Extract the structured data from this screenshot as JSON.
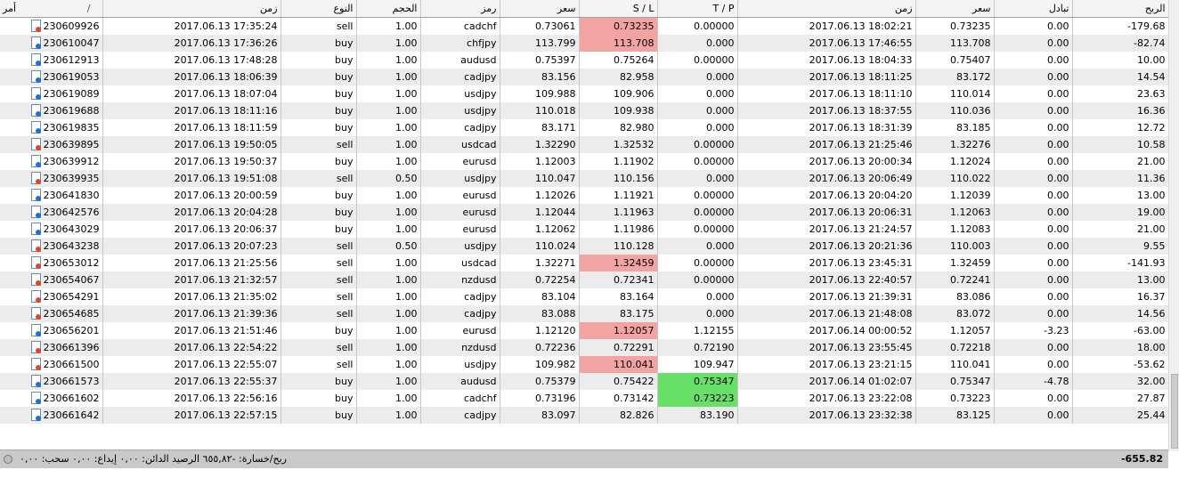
{
  "columns": {
    "order": "أمر",
    "open_time": "زمن",
    "type": "النوع",
    "volume": "الحجم",
    "symbol": "رمز",
    "open_price": "سعر",
    "sl": "S / L",
    "tp": "T / P",
    "close_time": "زمن",
    "close_price": "سعر",
    "swap": "تبادل",
    "profit": "الربح",
    "sort_indicator": "/"
  },
  "rows": [
    {
      "order": "230609926",
      "open_time": "2017.06.13 17:35:24",
      "type": "sell",
      "volume": "1.00",
      "symbol": "cadchf",
      "open_price": "0.73061",
      "sl": "0.73235",
      "tp": "0.00000",
      "close_time": "2017.06.13 18:02:21",
      "close_price": "0.73235",
      "swap": "0.00",
      "profit": "-179.68",
      "sl_hl": "red",
      "tp_hl": ""
    },
    {
      "order": "230610047",
      "open_time": "2017.06.13 17:36:26",
      "type": "buy",
      "volume": "1.00",
      "symbol": "chfjpy",
      "open_price": "113.799",
      "sl": "113.708",
      "tp": "0.000",
      "close_time": "2017.06.13 17:46:55",
      "close_price": "113.708",
      "swap": "0.00",
      "profit": "-82.74",
      "sl_hl": "red",
      "tp_hl": ""
    },
    {
      "order": "230612913",
      "open_time": "2017.06.13 17:48:28",
      "type": "buy",
      "volume": "1.00",
      "symbol": "audusd",
      "open_price": "0.75397",
      "sl": "0.75264",
      "tp": "0.00000",
      "close_time": "2017.06.13 18:04:33",
      "close_price": "0.75407",
      "swap": "0.00",
      "profit": "10.00",
      "sl_hl": "",
      "tp_hl": ""
    },
    {
      "order": "230619053",
      "open_time": "2017.06.13 18:06:39",
      "type": "buy",
      "volume": "1.00",
      "symbol": "cadjpy",
      "open_price": "83.156",
      "sl": "82.958",
      "tp": "0.000",
      "close_time": "2017.06.13 18:11:25",
      "close_price": "83.172",
      "swap": "0.00",
      "profit": "14.54",
      "sl_hl": "",
      "tp_hl": ""
    },
    {
      "order": "230619089",
      "open_time": "2017.06.13 18:07:04",
      "type": "buy",
      "volume": "1.00",
      "symbol": "usdjpy",
      "open_price": "109.988",
      "sl": "109.906",
      "tp": "0.000",
      "close_time": "2017.06.13 18:11:10",
      "close_price": "110.014",
      "swap": "0.00",
      "profit": "23.63",
      "sl_hl": "",
      "tp_hl": ""
    },
    {
      "order": "230619688",
      "open_time": "2017.06.13 18:11:16",
      "type": "buy",
      "volume": "1.00",
      "symbol": "usdjpy",
      "open_price": "110.018",
      "sl": "109.938",
      "tp": "0.000",
      "close_time": "2017.06.13 18:37:55",
      "close_price": "110.036",
      "swap": "0.00",
      "profit": "16.36",
      "sl_hl": "",
      "tp_hl": ""
    },
    {
      "order": "230619835",
      "open_time": "2017.06.13 18:11:59",
      "type": "buy",
      "volume": "1.00",
      "symbol": "cadjpy",
      "open_price": "83.171",
      "sl": "82.980",
      "tp": "0.000",
      "close_time": "2017.06.13 18:31:39",
      "close_price": "83.185",
      "swap": "0.00",
      "profit": "12.72",
      "sl_hl": "",
      "tp_hl": ""
    },
    {
      "order": "230639895",
      "open_time": "2017.06.13 19:50:05",
      "type": "sell",
      "volume": "1.00",
      "symbol": "usdcad",
      "open_price": "1.32290",
      "sl": "1.32532",
      "tp": "0.00000",
      "close_time": "2017.06.13 21:25:46",
      "close_price": "1.32276",
      "swap": "0.00",
      "profit": "10.58",
      "sl_hl": "",
      "tp_hl": ""
    },
    {
      "order": "230639912",
      "open_time": "2017.06.13 19:50:37",
      "type": "buy",
      "volume": "1.00",
      "symbol": "eurusd",
      "open_price": "1.12003",
      "sl": "1.11902",
      "tp": "0.00000",
      "close_time": "2017.06.13 20:00:34",
      "close_price": "1.12024",
      "swap": "0.00",
      "profit": "21.00",
      "sl_hl": "",
      "tp_hl": ""
    },
    {
      "order": "230639935",
      "open_time": "2017.06.13 19:51:08",
      "type": "sell",
      "volume": "0.50",
      "symbol": "usdjpy",
      "open_price": "110.047",
      "sl": "110.156",
      "tp": "0.000",
      "close_time": "2017.06.13 20:06:49",
      "close_price": "110.022",
      "swap": "0.00",
      "profit": "11.36",
      "sl_hl": "",
      "tp_hl": ""
    },
    {
      "order": "230641830",
      "open_time": "2017.06.13 20:00:59",
      "type": "buy",
      "volume": "1.00",
      "symbol": "eurusd",
      "open_price": "1.12026",
      "sl": "1.11921",
      "tp": "0.00000",
      "close_time": "2017.06.13 20:04:20",
      "close_price": "1.12039",
      "swap": "0.00",
      "profit": "13.00",
      "sl_hl": "",
      "tp_hl": ""
    },
    {
      "order": "230642576",
      "open_time": "2017.06.13 20:04:28",
      "type": "buy",
      "volume": "1.00",
      "symbol": "eurusd",
      "open_price": "1.12044",
      "sl": "1.11963",
      "tp": "0.00000",
      "close_time": "2017.06.13 20:06:31",
      "close_price": "1.12063",
      "swap": "0.00",
      "profit": "19.00",
      "sl_hl": "",
      "tp_hl": ""
    },
    {
      "order": "230643029",
      "open_time": "2017.06.13 20:06:37",
      "type": "buy",
      "volume": "1.00",
      "symbol": "eurusd",
      "open_price": "1.12062",
      "sl": "1.11986",
      "tp": "0.00000",
      "close_time": "2017.06.13 21:24:57",
      "close_price": "1.12083",
      "swap": "0.00",
      "profit": "21.00",
      "sl_hl": "",
      "tp_hl": ""
    },
    {
      "order": "230643238",
      "open_time": "2017.06.13 20:07:23",
      "type": "sell",
      "volume": "0.50",
      "symbol": "usdjpy",
      "open_price": "110.024",
      "sl": "110.128",
      "tp": "0.000",
      "close_time": "2017.06.13 20:21:36",
      "close_price": "110.003",
      "swap": "0.00",
      "profit": "9.55",
      "sl_hl": "",
      "tp_hl": ""
    },
    {
      "order": "230653012",
      "open_time": "2017.06.13 21:25:56",
      "type": "sell",
      "volume": "1.00",
      "symbol": "usdcad",
      "open_price": "1.32271",
      "sl": "1.32459",
      "tp": "0.00000",
      "close_time": "2017.06.13 23:45:31",
      "close_price": "1.32459",
      "swap": "0.00",
      "profit": "-141.93",
      "sl_hl": "red",
      "tp_hl": ""
    },
    {
      "order": "230654067",
      "open_time": "2017.06.13 21:32:57",
      "type": "sell",
      "volume": "1.00",
      "symbol": "nzdusd",
      "open_price": "0.72254",
      "sl": "0.72341",
      "tp": "0.00000",
      "close_time": "2017.06.13 22:40:57",
      "close_price": "0.72241",
      "swap": "0.00",
      "profit": "13.00",
      "sl_hl": "",
      "tp_hl": ""
    },
    {
      "order": "230654291",
      "open_time": "2017.06.13 21:35:02",
      "type": "sell",
      "volume": "1.00",
      "symbol": "cadjpy",
      "open_price": "83.104",
      "sl": "83.164",
      "tp": "0.000",
      "close_time": "2017.06.13 21:39:31",
      "close_price": "83.086",
      "swap": "0.00",
      "profit": "16.37",
      "sl_hl": "",
      "tp_hl": ""
    },
    {
      "order": "230654685",
      "open_time": "2017.06.13 21:39:36",
      "type": "sell",
      "volume": "1.00",
      "symbol": "cadjpy",
      "open_price": "83.088",
      "sl": "83.175",
      "tp": "0.000",
      "close_time": "2017.06.13 21:48:08",
      "close_price": "83.072",
      "swap": "0.00",
      "profit": "14.56",
      "sl_hl": "",
      "tp_hl": ""
    },
    {
      "order": "230656201",
      "open_time": "2017.06.13 21:51:46",
      "type": "buy",
      "volume": "1.00",
      "symbol": "eurusd",
      "open_price": "1.12120",
      "sl": "1.12057",
      "tp": "1.12155",
      "close_time": "2017.06.14 00:00:52",
      "close_price": "1.12057",
      "swap": "-3.23",
      "profit": "-63.00",
      "sl_hl": "red",
      "tp_hl": ""
    },
    {
      "order": "230661396",
      "open_time": "2017.06.13 22:54:22",
      "type": "sell",
      "volume": "1.00",
      "symbol": "nzdusd",
      "open_price": "0.72236",
      "sl": "0.72291",
      "tp": "0.72190",
      "close_time": "2017.06.13 23:55:45",
      "close_price": "0.72218",
      "swap": "0.00",
      "profit": "18.00",
      "sl_hl": "",
      "tp_hl": ""
    },
    {
      "order": "230661500",
      "open_time": "2017.06.13 22:55:07",
      "type": "sell",
      "volume": "1.00",
      "symbol": "usdjpy",
      "open_price": "109.982",
      "sl": "110.041",
      "tp": "109.947",
      "close_time": "2017.06.13 23:21:15",
      "close_price": "110.041",
      "swap": "0.00",
      "profit": "-53.62",
      "sl_hl": "red",
      "tp_hl": ""
    },
    {
      "order": "230661573",
      "open_time": "2017.06.13 22:55:37",
      "type": "buy",
      "volume": "1.00",
      "symbol": "audusd",
      "open_price": "0.75379",
      "sl": "0.75422",
      "tp": "0.75347",
      "close_time": "2017.06.14 01:02:07",
      "close_price": "0.75347",
      "swap": "-4.78",
      "profit": "32.00",
      "sl_hl": "",
      "tp_hl": "green"
    },
    {
      "order": "230661602",
      "open_time": "2017.06.13 22:56:16",
      "type": "buy",
      "volume": "1.00",
      "symbol": "cadchf",
      "open_price": "0.73196",
      "sl": "0.73142",
      "tp": "0.73223",
      "close_time": "2017.06.13 23:22:08",
      "close_price": "0.73223",
      "swap": "0.00",
      "profit": "27.87",
      "sl_hl": "",
      "tp_hl": "green"
    },
    {
      "order": "230661642",
      "open_time": "2017.06.13 22:57:15",
      "type": "buy",
      "volume": "1.00",
      "symbol": "cadjpy",
      "open_price": "83.097",
      "sl": "82.826",
      "tp": "83.190",
      "close_time": "2017.06.13 23:32:38",
      "close_price": "83.125",
      "swap": "0.00",
      "profit": "25.44",
      "sl_hl": "",
      "tp_hl": ""
    }
  ],
  "footer": {
    "summary": "ربح/خسارة: -٦٥٥,٨٢  الرصيد الدائن: ٠,٠٠  إيداع: ٠,٠٠  سحب: ٠,٠٠",
    "total": "-655.82"
  },
  "colors": {
    "sl_hit": "#f4a3a3",
    "tp_hit": "#66e066",
    "footer_bg": "#c9c9c9"
  },
  "icons": {
    "buy": "buy-ticket-icon",
    "sell": "sell-ticket-icon"
  }
}
